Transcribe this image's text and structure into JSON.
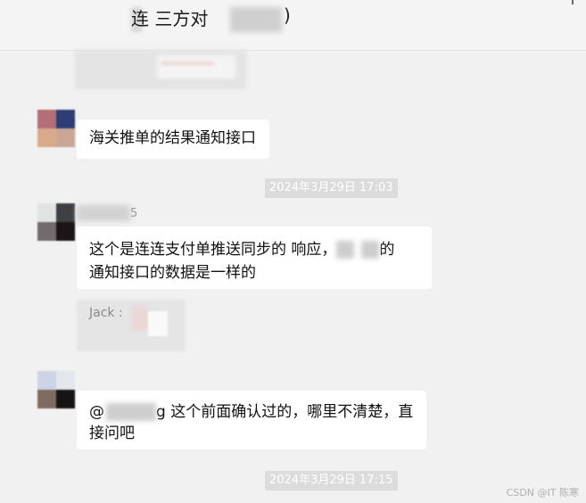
{
  "header": {
    "title": "连 三方对",
    "title_suffix": ")"
  },
  "messages": [
    {
      "type": "text",
      "text": "海关推单的结果通知接口"
    },
    {
      "type": "timestamp",
      "text": "2024年3月29日 17:03"
    },
    {
      "type": "sender",
      "name_fragment": "5"
    },
    {
      "type": "text",
      "lines": [
        "这个是连连支付单推送同步的 响应，",
        "的",
        "通知接口的数据是一样的"
      ]
    },
    {
      "type": "quote",
      "label": "Jack :"
    },
    {
      "type": "text",
      "mention": "@",
      "lines": [
        "g 这个前面确认过的，哪里不清楚，直",
        "接问吧"
      ]
    },
    {
      "type": "timestamp",
      "text": "2024年3月29日 17:15"
    }
  ],
  "watermark": "CSDN @IT 陈寒"
}
